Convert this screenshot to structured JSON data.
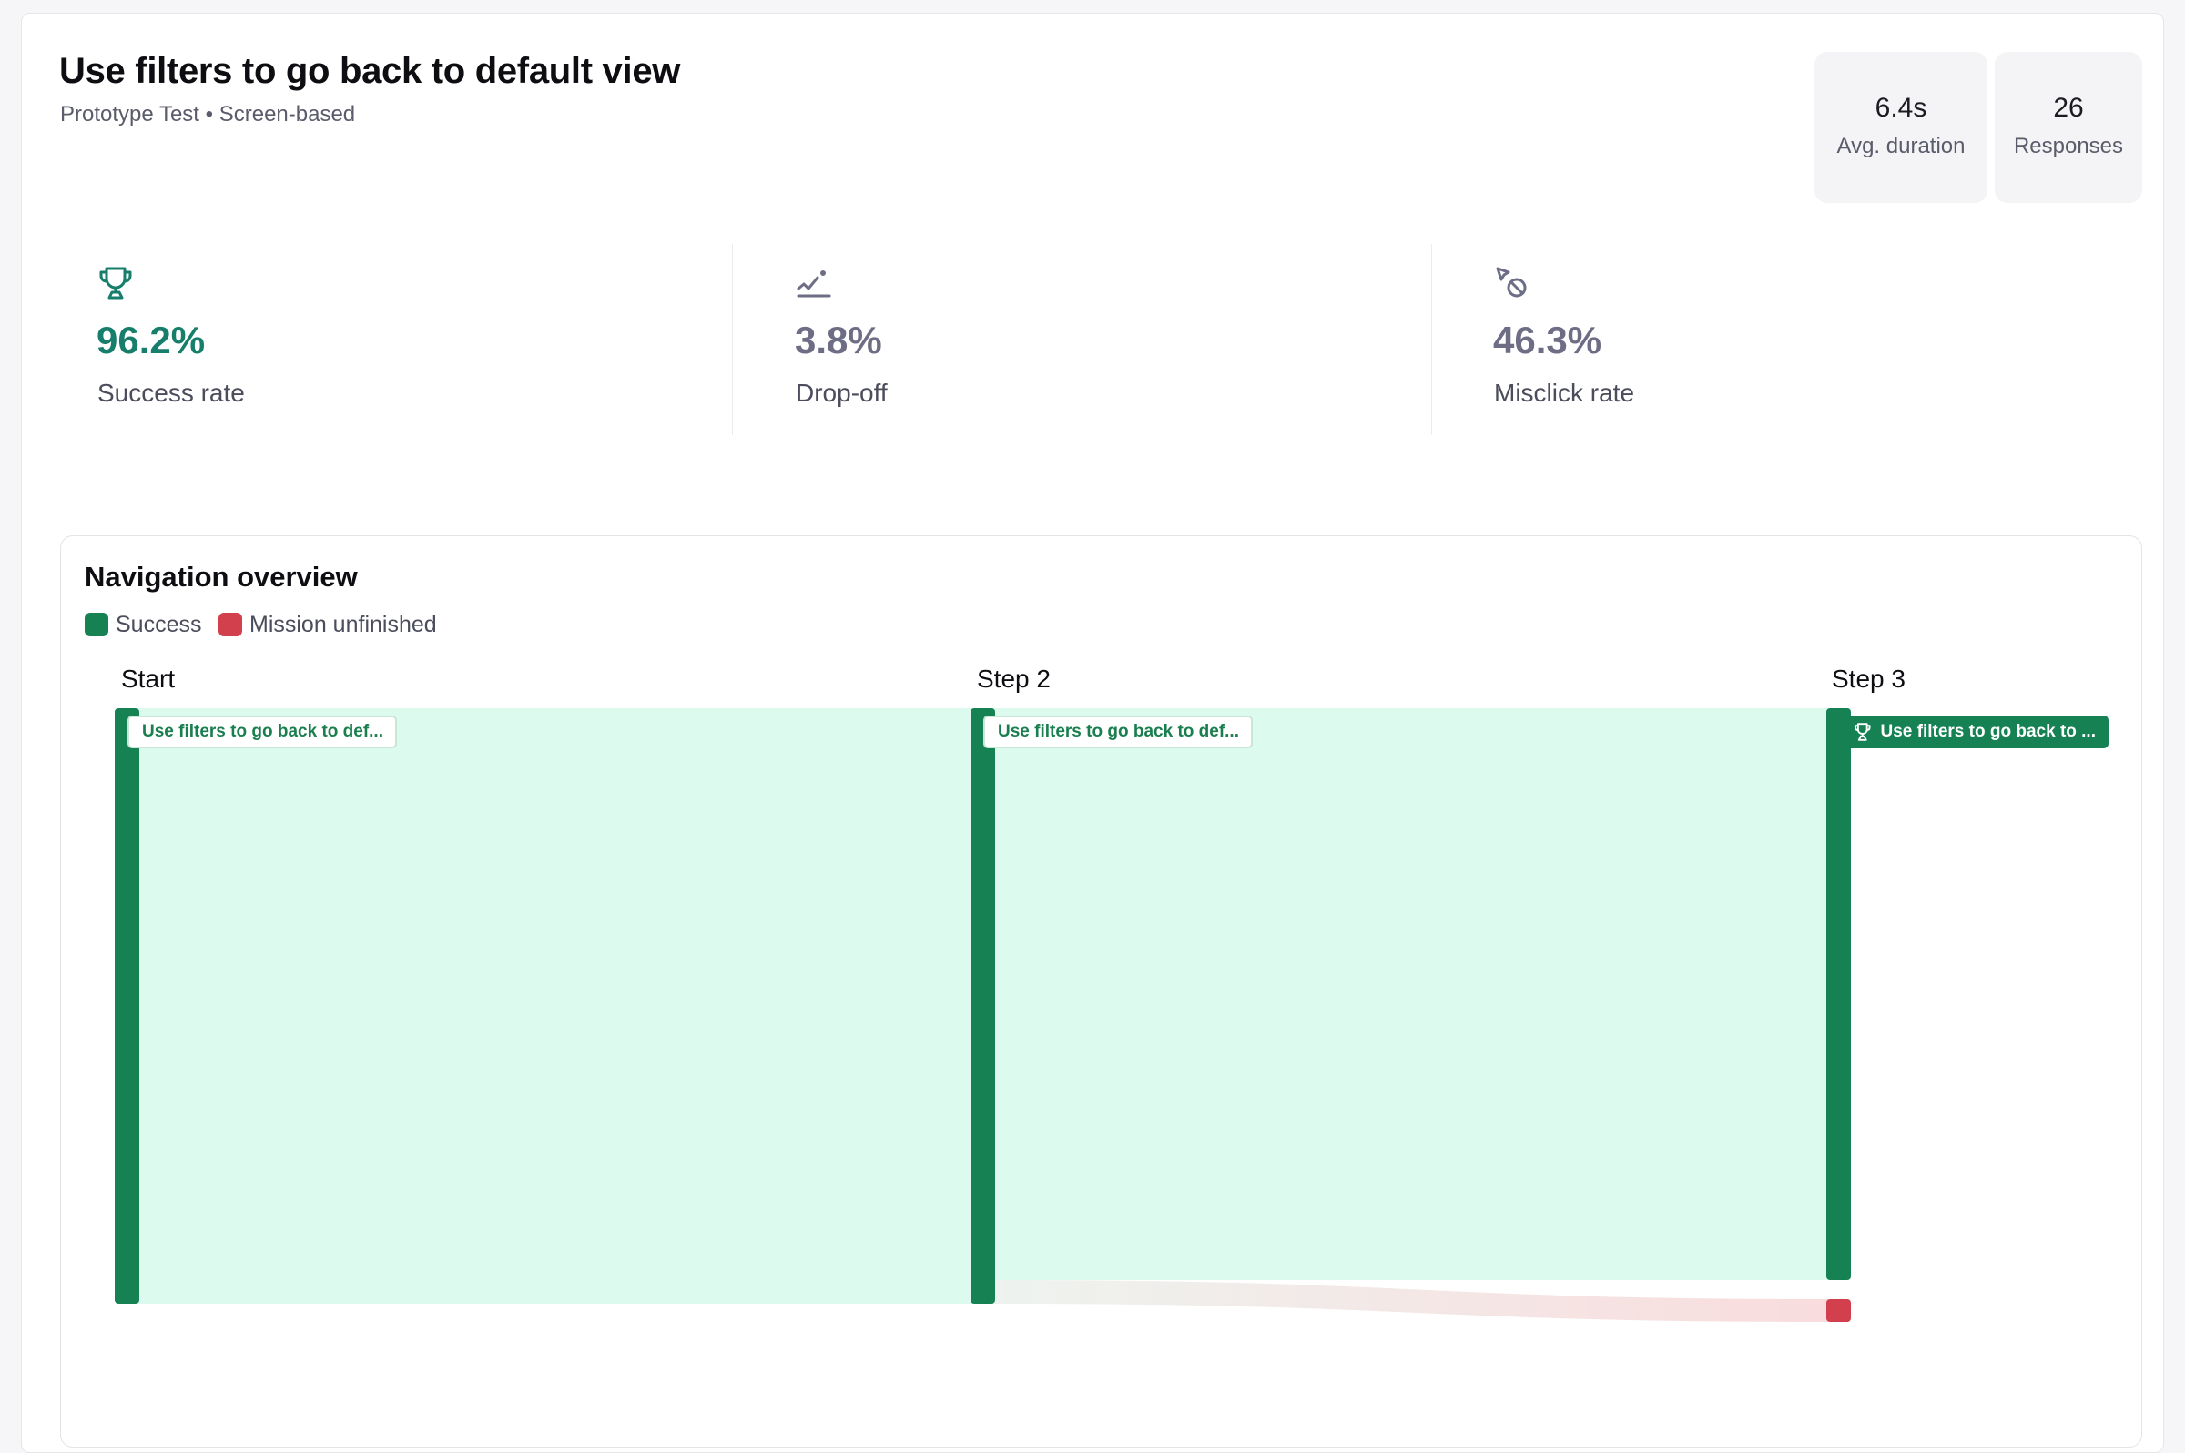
{
  "header": {
    "title": "Use filters to go back to default view",
    "subtitle": "Prototype Test • Screen-based"
  },
  "stats": [
    {
      "value": "6.4s",
      "label": "Avg. duration"
    },
    {
      "value": "26",
      "label": "Responses"
    }
  ],
  "metrics": [
    {
      "icon": "trophy-icon",
      "value": "96.2%",
      "label": "Success rate",
      "color": "#167e6b"
    },
    {
      "icon": "drop-off-icon",
      "value": "3.8%",
      "label": "Drop-off",
      "color": "#6d6e85"
    },
    {
      "icon": "misclick-icon",
      "value": "46.3%",
      "label": "Misclick rate",
      "color": "#6d6e85"
    }
  ],
  "navigation": {
    "title": "Navigation overview",
    "legend": [
      {
        "label": "Success",
        "color": "#168253"
      },
      {
        "label": "Mission unfinished",
        "color": "#d2404d"
      }
    ],
    "steps": [
      "Start",
      "Step 2",
      "Step 3"
    ],
    "nodes": [
      {
        "step": "Start",
        "label": "Use filters to go back to def...",
        "status": "path"
      },
      {
        "step": "Step 2",
        "label": "Use filters to go back to def...",
        "status": "path"
      },
      {
        "step": "Step 3",
        "label": "Use filters to go back to ...",
        "status": "success",
        "icon": "trophy-icon"
      }
    ],
    "colors": {
      "success": "#168253",
      "flow": "#dcfaed",
      "unfinished": "#d2404d"
    }
  }
}
